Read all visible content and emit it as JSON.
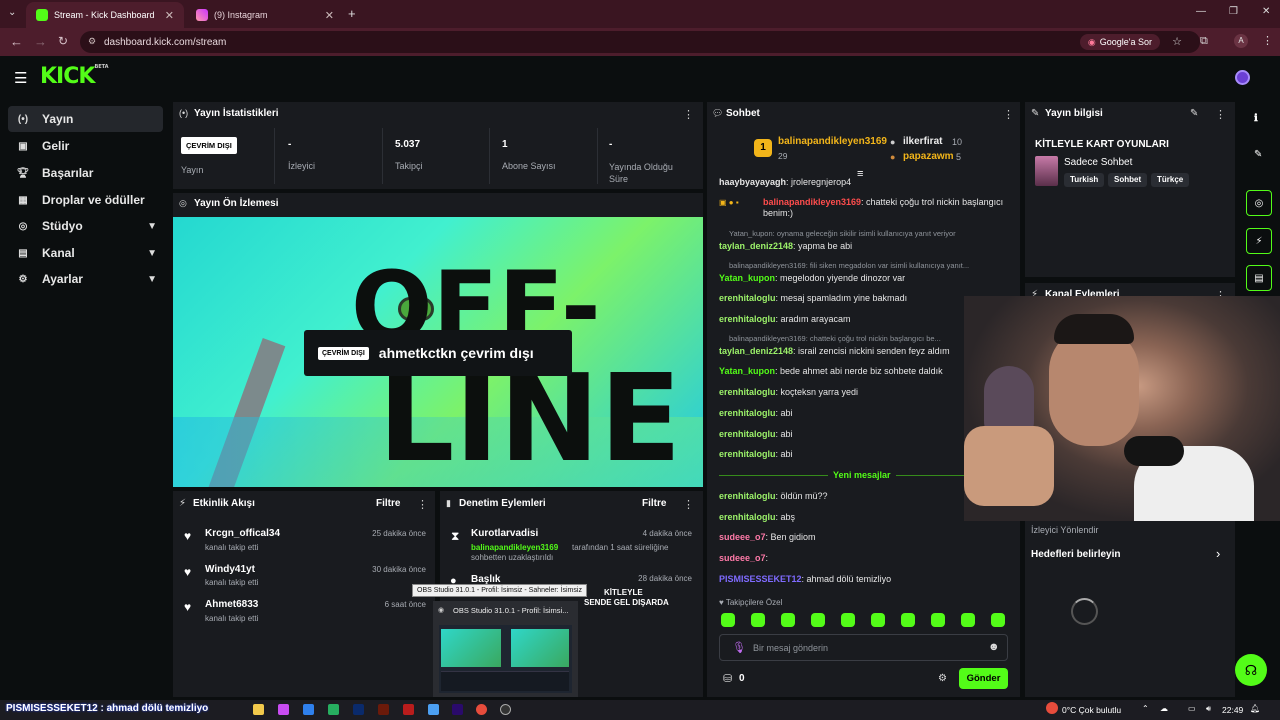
{
  "browser": {
    "tabs": [
      {
        "title": "Stream - Kick Dashboard",
        "active": true
      },
      {
        "title": "(9) Instagram",
        "active": false
      }
    ],
    "url": "dashboard.kick.com/stream",
    "google_btn": "Google'a Sor",
    "profile_initial": "A"
  },
  "sidebar": {
    "items": [
      {
        "label": "Yayın",
        "icon": "broadcast-icon"
      },
      {
        "label": "Gelir",
        "icon": "revenue-icon"
      },
      {
        "label": "Başarılar",
        "icon": "trophy-icon"
      },
      {
        "label": "Droplar ve ödüller",
        "icon": "gift-icon"
      },
      {
        "label": "Stüdyo",
        "icon": "studio-icon"
      },
      {
        "label": "Kanal",
        "icon": "channel-icon"
      },
      {
        "label": "Ayarlar",
        "icon": "gear-icon"
      }
    ]
  },
  "stats": {
    "title": "Yayın İstatistikleri",
    "status_badge": "ÇEVRİM DIŞI",
    "status_label": "Yayın",
    "viewers_value": "-",
    "viewers_label": "İzleyici",
    "followers_value": "5.037",
    "followers_label": "Takipçi",
    "subs_value": "1",
    "subs_label": "Abone Sayısı",
    "duration_value": "-",
    "duration_label": "Yayında Olduğu Süre"
  },
  "preview": {
    "title": "Yayın Ön İzlemesi",
    "big_top": "OFF-",
    "big_bottom": "LINE",
    "badge": "ÇEVRİM DIŞI",
    "message": "ahmetkctkn çevrim dışı"
  },
  "events": {
    "title": "Etkinlik Akışı",
    "filter": "Filtre",
    "items": [
      {
        "name": "Krcgn_offical34",
        "sub": "kanalı takip etti",
        "time": "25 dakika önce"
      },
      {
        "name": "Windy41yt",
        "sub": "kanalı takip etti",
        "time": "30 dakika önce"
      },
      {
        "name": "Ahmet6833",
        "sub": "kanalı takip etti",
        "time": "6 saat önce"
      }
    ]
  },
  "moderation": {
    "title": "Denetim Eylemleri",
    "filter": "Filtre",
    "items": [
      {
        "name": "Kurotlarvadisi",
        "time": "4 dakika önce",
        "by": "balinapandikleyen3169",
        "sub1": "tarafından 1 saat süreliğine",
        "sub2": "sohbetten uzaklaştırıldı"
      },
      {
        "name": "Başlık",
        "time": "28 dakika önce",
        "sub1": "KİTLEYLE",
        "sub2": "SENDE GEL DIŞARDA"
      }
    ],
    "obs_tooltip": "OBS Studio 31.0.1 - Profil: İsimsiz - Sahneler: İsimsiz",
    "obs_title": "OBS Studio 31.0.1 - Profil: İsimsi..."
  },
  "chat": {
    "title": "Sohbet",
    "top_chatters": [
      {
        "rank": "1",
        "name": "balinapandikleyen3169",
        "count": "29"
      },
      {
        "name": "ilkerfirat",
        "count": "10"
      },
      {
        "name": "papazawm",
        "count": "5"
      }
    ],
    "new_messages": "Yeni mesajlar",
    "messages": [
      {
        "user": "haaybyayayagh",
        "text": ": jroleregnjerop4",
        "color": "#e6e6e6"
      },
      {
        "user": "balinapandikleyen3169",
        "text": ": chatteki çoğu trol nickin başlangıcı benim:)",
        "color": "#ff4d4d"
      },
      {
        "reply": "Yatan_kupon: oynama geleceğin sikilir isimli kullanıcıya yanıt veriyor"
      },
      {
        "user": "taylan_deniz2148",
        "text": ": yapma be abi",
        "color": "#9cf26a"
      },
      {
        "reply": "balinapandikleyen3169: fili siken megadolon var isimli kullanıcıya yanıt..."
      },
      {
        "user": "Yatan_kupon",
        "text": ": megelodon yiyende dinozor var",
        "color": "#53fc18"
      },
      {
        "user": "erenhitaloglu",
        "text": ": mesaj spamladım yine bakmadı",
        "color": "#9cf26a"
      },
      {
        "user": "erenhitaloglu",
        "text": ": aradım arayacam",
        "color": "#9cf26a"
      },
      {
        "reply": "balinapandikleyen3169: chatteki çoğu trol nickin başlangıcı be..."
      },
      {
        "user": "taylan_deniz2148",
        "text": ": israil zencisi nickini senden feyz aldım",
        "color": "#9cf26a"
      },
      {
        "user": "Yatan_kupon",
        "text": ": bede ahmet abi nerde biz sohbete daldık",
        "color": "#53fc18"
      },
      {
        "user": "erenhitaloglu",
        "text": ": koçteksn yarra yedi",
        "color": "#9cf26a"
      },
      {
        "user": "erenhitaloglu",
        "text": ": abi",
        "color": "#9cf26a"
      },
      {
        "user": "erenhitaloglu",
        "text": ": abi",
        "color": "#9cf26a"
      },
      {
        "user": "erenhitaloglu",
        "text": ": abi",
        "color": "#9cf26a"
      },
      {
        "user": "erenhitaloglu",
        "text": ": öldün mü??",
        "color": "#9cf26a"
      },
      {
        "user": "erenhitaloglu",
        "text": ": abş",
        "color": "#9cf26a"
      },
      {
        "user": "sudeee_o7",
        "text": ": Ben gidiom",
        "color": "#ff7aa8"
      },
      {
        "user": "sudeee_o7",
        "text": ":",
        "color": "#ff7aa8"
      },
      {
        "user": "PISMISESSEKET12",
        "text": ": ahmad dölü temizliyo",
        "color": "#7f6bff"
      }
    ],
    "followers_only": "Takipçilere Özel",
    "input_placeholder": "Bir mesaj gönderin",
    "points": "0",
    "send": "Gönder"
  },
  "stream_info": {
    "title": "Yayın bilgisi",
    "stream_title": "KİTLEYLE KART OYUNLARI",
    "category": "Sadece Sohbet",
    "tags": [
      "Turkish",
      "Sohbet",
      "Türkçe"
    ]
  },
  "channel_actions": {
    "title": "Kanal Eylemleri",
    "viewer_redirect": "İzleyici Yönlendir",
    "set_goals": "Hedefleri belirleyin"
  },
  "taskbar": {
    "overlay": "PISMISESSEKET12 : ahmad dölü temizliyo",
    "weather": "0°C  Çok bulutlu",
    "time": "22:49"
  }
}
